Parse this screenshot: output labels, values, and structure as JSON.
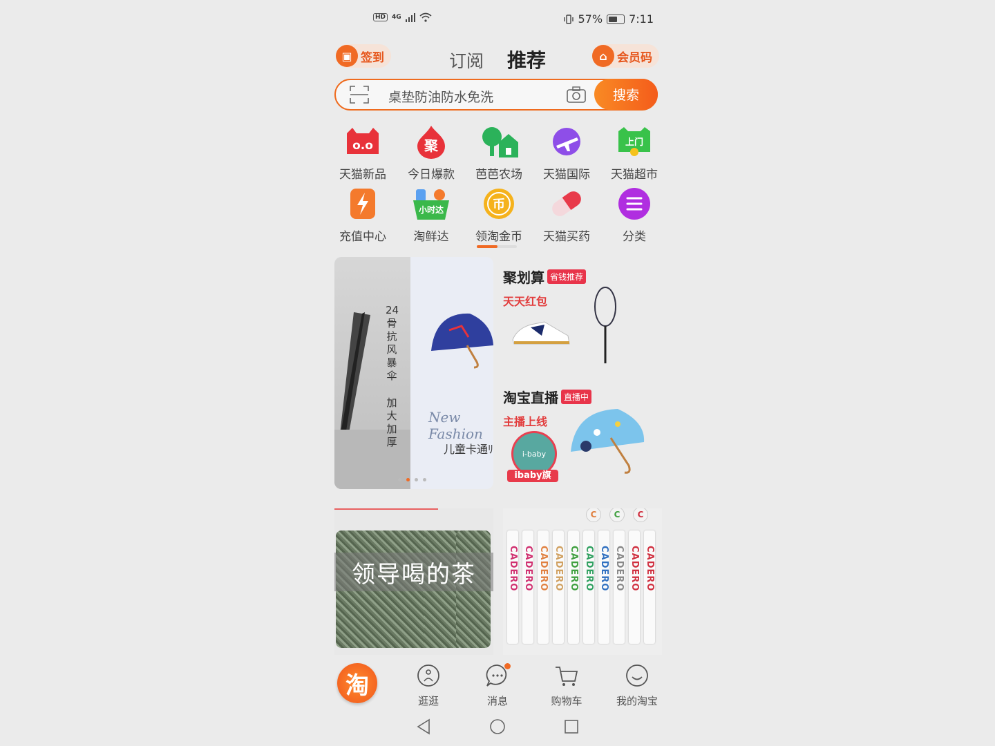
{
  "status": {
    "network": "4G",
    "battery": "57%",
    "time": "7:11",
    "hd": "HD"
  },
  "header": {
    "checkin": "签到",
    "tabs": [
      "订阅",
      "推荐"
    ],
    "member_code": "会员码"
  },
  "search": {
    "placeholder": "桌垫防油防水免洗",
    "button": "搜索"
  },
  "grid": [
    {
      "label": "天猫新品",
      "icon": "tmall-cat-icon",
      "color": "#e8323a"
    },
    {
      "label": "今日爆款",
      "icon": "fire-ju-icon",
      "color": "#e8323a"
    },
    {
      "label": "芭芭农场",
      "icon": "farm-tree-icon",
      "color": "#2bb25a"
    },
    {
      "label": "天猫国际",
      "icon": "plane-globe-icon",
      "color": "#8e4ee8"
    },
    {
      "label": "天猫超市",
      "icon": "supermarket-icon",
      "color": "#39c24a"
    },
    {
      "label": "充值中心",
      "icon": "lightning-icon",
      "color": "#f47a2c"
    },
    {
      "label": "淘鲜达",
      "icon": "grocery-basket-icon",
      "color": "#3ab84a"
    },
    {
      "label": "领淘金币",
      "icon": "gold-coin-icon",
      "color": "#f5b21c"
    },
    {
      "label": "天猫买药",
      "icon": "pill-icon",
      "color": "#e83a4a"
    },
    {
      "label": "分类",
      "icon": "menu-list-icon",
      "color": "#b02ee0"
    }
  ],
  "grid_icon_text": {
    "juhua": "聚",
    "shangmen": "上门",
    "xiaoshida": "小时达",
    "coin": "币"
  },
  "banner": {
    "vertical_text": "24骨抗风暴伞",
    "vertical_text2": "加大加厚",
    "fashion": "New Fashion",
    "caption": "儿童卡通ﾘ"
  },
  "cards": [
    {
      "title": "聚划算",
      "badge": "省钱推荐",
      "subtitle": "天天红包"
    },
    {
      "title": "淘宝直播",
      "badge": "直播中",
      "subtitle": "主播上线",
      "store": "ibaby旗",
      "store_logo": "i-baby"
    }
  ],
  "tiles": {
    "tea_label": "领导喝的茶",
    "grips_brand": "CADERO"
  },
  "nav": [
    {
      "label": "逛逛",
      "icon": "stroll-icon"
    },
    {
      "label": "消息",
      "icon": "message-icon"
    },
    {
      "label": "购物车",
      "icon": "cart-icon"
    },
    {
      "label": "我的淘宝",
      "icon": "profile-smile-icon"
    }
  ],
  "nav_logo": "淘"
}
